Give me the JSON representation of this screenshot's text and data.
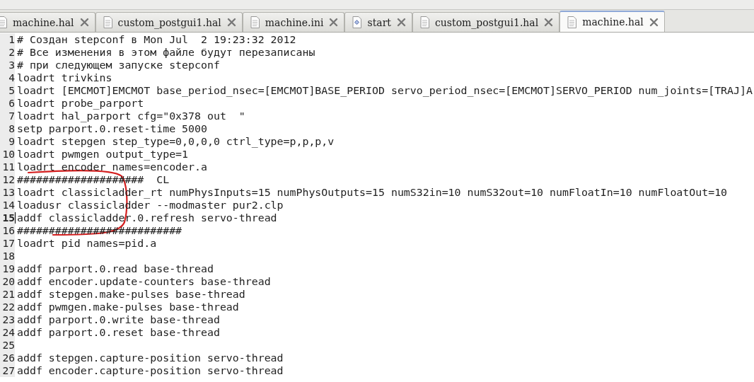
{
  "tabs": [
    {
      "label": "machine.hal",
      "kind": "document",
      "selected": false
    },
    {
      "label": "custom_postgui1.hal",
      "kind": "document",
      "selected": false
    },
    {
      "label": "machine.ini",
      "kind": "document",
      "selected": false
    },
    {
      "label": "start",
      "kind": "script",
      "selected": false
    },
    {
      "label": "custom_postgui1.hal",
      "kind": "document",
      "selected": false
    },
    {
      "label": "machine.hal",
      "kind": "document",
      "selected": true
    }
  ],
  "editor": {
    "lines": [
      {
        "number": "1",
        "text": "# Создан stepconf в Mon Jul  2 19:23:32 2012",
        "current": false
      },
      {
        "number": "2",
        "text": "# Все изменения в этом файле будут перезаписаны",
        "current": false
      },
      {
        "number": "3",
        "text": "# при следующем запуске stepconf",
        "current": false
      },
      {
        "number": "4",
        "text": "loadrt trivkins",
        "current": false
      },
      {
        "number": "5",
        "text": "loadrt [EMCMOT]EMCMOT base_period_nsec=[EMCMOT]BASE_PERIOD servo_period_nsec=[EMCMOT]SERVO_PERIOD num_joints=[TRAJ]A",
        "current": false
      },
      {
        "number": "6",
        "text": "loadrt probe_parport",
        "current": false
      },
      {
        "number": "7",
        "text": "loadrt hal_parport cfg=\"0x378 out  \"",
        "current": false
      },
      {
        "number": "8",
        "text": "setp parport.0.reset-time 5000",
        "current": false
      },
      {
        "number": "9",
        "text": "loadrt stepgen step_type=0,0,0,0 ctrl_type=p,p,p,v",
        "current": false
      },
      {
        "number": "10",
        "text": "loadrt pwmgen output_type=1",
        "current": false
      },
      {
        "number": "11",
        "text": "loadrt encoder names=encoder.a",
        "current": false
      },
      {
        "number": "12",
        "text": "####################  CL",
        "current": false
      },
      {
        "number": "13",
        "text": "loadrt classicladder_rt numPhysInputs=15 numPhysOutputs=15 numS32in=10 numS32out=10 numFloatIn=10 numFloatOut=10",
        "current": false
      },
      {
        "number": "14",
        "text": "loadusr classicladder --modmaster pur2.clp",
        "current": false
      },
      {
        "number": "15",
        "text": "addf classicladder.0.refresh servo-thread",
        "current": true
      },
      {
        "number": "16",
        "text": "##########################",
        "current": false
      },
      {
        "number": "17",
        "text": "loadrt pid names=pid.a",
        "current": false
      },
      {
        "number": "18",
        "current": false
      },
      {
        "number": "19",
        "text": "addf parport.0.read base-thread",
        "current": false
      },
      {
        "number": "20",
        "text": "addf encoder.update-counters base-thread",
        "current": false
      },
      {
        "number": "21",
        "text": "addf stepgen.make-pulses base-thread",
        "current": false
      },
      {
        "number": "22",
        "text": "addf pwmgen.make-pulses base-thread",
        "current": false
      },
      {
        "number": "23",
        "text": "addf parport.0.write base-thread",
        "current": false
      },
      {
        "number": "24",
        "text": "addf parport.0.reset base-thread",
        "current": false
      },
      {
        "number": "25",
        "current": false
      },
      {
        "number": "26",
        "text": "addf stepgen.capture-position servo-thread",
        "current": false
      },
      {
        "number": "27",
        "text": "addf encoder.capture-position servo-thread",
        "current": false
      }
    ]
  }
}
